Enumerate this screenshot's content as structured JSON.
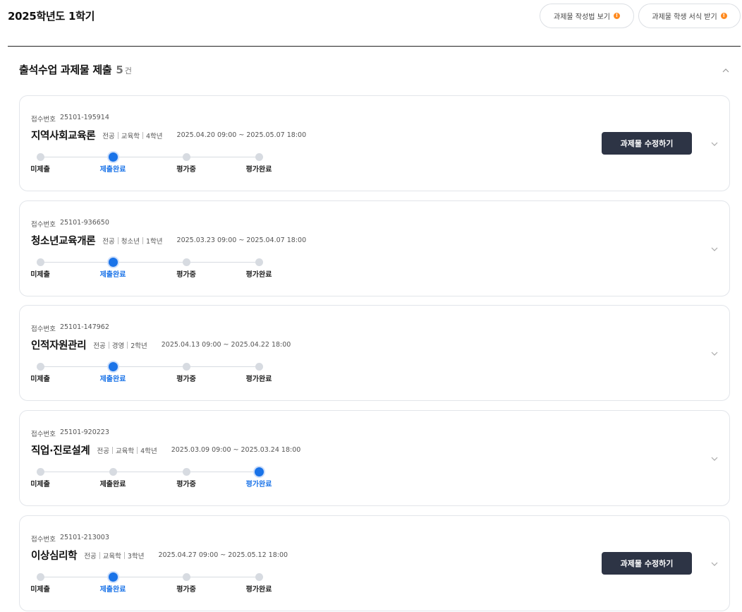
{
  "page": {
    "title": "2025학년도 1학기"
  },
  "header_buttons": [
    {
      "label": "과제물 작성법 보기",
      "warn": "!"
    },
    {
      "label": "과제물 학생 서식 받기",
      "warn": "!"
    }
  ],
  "section": {
    "title": "출석수업 과제물 제출",
    "count": "5",
    "count_unit": "건"
  },
  "steps": [
    "미제출",
    "제출완료",
    "평가중",
    "평가완료"
  ],
  "accent_color": "#1a73e8",
  "cards": [
    {
      "receipt_label": "접수번호",
      "receipt_no": "25101-195914",
      "name": "지역사회교육론",
      "type": "전공",
      "dept": "교육학",
      "grade": "4학년",
      "period": "2025.04.20 09:00 ~ 2025.05.07 18:00",
      "active_step": "제출완료",
      "edit_label": "과제물 수정하기"
    },
    {
      "receipt_label": "접수번호",
      "receipt_no": "25101-936650",
      "name": "청소년교육개론",
      "type": "전공",
      "dept": "청소년",
      "grade": "1학년",
      "period": "2025.03.23 09:00 ~ 2025.04.07 18:00",
      "active_step": "제출완료",
      "edit_label": ""
    },
    {
      "receipt_label": "접수번호",
      "receipt_no": "25101-147962",
      "name": "인적자원관리",
      "type": "전공",
      "dept": "경영",
      "grade": "2학년",
      "period": "2025.04.13 09:00 ~ 2025.04.22 18:00",
      "active_step": "제출완료",
      "edit_label": ""
    },
    {
      "receipt_label": "접수번호",
      "receipt_no": "25101-920223",
      "name": "직업·진로설계",
      "type": "전공",
      "dept": "교육학",
      "grade": "4학년",
      "period": "2025.03.09 09:00 ~ 2025.03.24 18:00",
      "active_step": "평가완료",
      "edit_label": ""
    },
    {
      "receipt_label": "접수번호",
      "receipt_no": "25101-213003",
      "name": "이상심리학",
      "type": "전공",
      "dept": "교육학",
      "grade": "3학년",
      "period": "2025.04.27 09:00 ~ 2025.05.12 18:00",
      "active_step": "제출완료",
      "edit_label": "과제물 수정하기"
    }
  ]
}
